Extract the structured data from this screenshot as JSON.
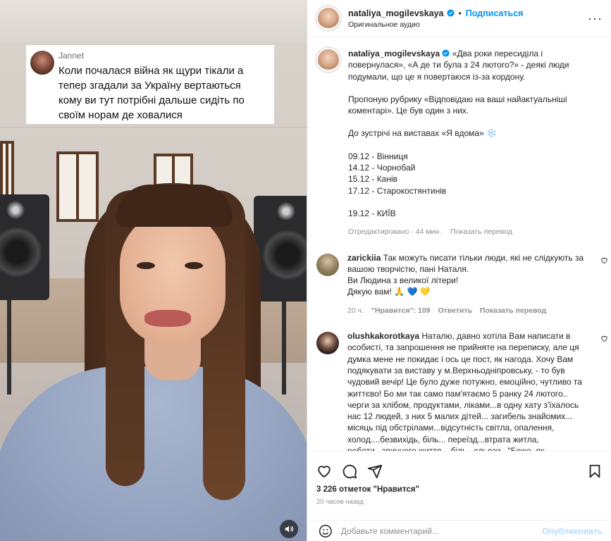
{
  "video": {
    "overlay": {
      "name": "Jannet",
      "text": "Коли почалася війна як щури тікали а тепер згадали за Україну вертаються кому ви тут потрібні дальше сидіть по своїм норам де ховалися"
    },
    "mute_icon": "speaker-icon"
  },
  "header": {
    "username": "nataliya_mogilevskaya",
    "separator": "•",
    "follow_label": "Подписаться",
    "audio_label": "Оригинальное аудио",
    "more_label": "···"
  },
  "caption": {
    "username": "nataliya_mogilevskaya",
    "line1": "«Два роки пересиділа і повернулася», «А де ти була з 24 лютого?» - деякі люди подумали, що це я повертаюся із-за кордону.",
    "line2": "Пропоную рубрику «Відповідаю на ваші найактуальніші коментарі». Це був один з них.",
    "line3": "До зустрічі на виставах «Я вдома» ❄️",
    "dates": [
      "09.12 - Вінниця",
      "14.12 - Чорнобай",
      "15.12 - Канів",
      "17.12 - Старокостянтинів"
    ],
    "last_date": "19.12 - КИЇВ",
    "edited": "Отредактировано · 44 мин.",
    "translate": "Показать перевод"
  },
  "comments": [
    {
      "username": "zarickiia",
      "text_lines": [
        "Так можуть писати тільки люди, які не слідкують за вашою творчістю, пані Наталя.",
        "Ви Людина з великої літери!",
        "Дякую вам! 🙏 💙 💛"
      ],
      "time": "20 ч.",
      "likes": "\"Нравится\": 109",
      "reply": "Ответить",
      "translate": "Показать перевод"
    },
    {
      "username": "olushkakorotkaya",
      "text": "Наталю, давно хотіла Вам написати в особисті, та запрошення не прийняте на переписку, але ця думка мене не покидає і ось це пост, як нагода. Хочу Вам подякувати за виставу у м.Верхньодніпровську, - то був чудовий вечір! Це було дуже потужно, емоційно, чутливо та життєво! Бо ми так само пам'ятаємо 5 ранку 24 лютого.. черги за хлібом, продуктами, ліками...в одну хату з'їхалось нас 12 людей, з них 5 малих дітей... загибель знайомих... місяць під обстрілами...відсутність світла, опалення, холод....безвихідь, біль... переїзд...втрата житла, роботи...звичного життя....біль...сльози...\"Боже, як боляче\"...нескінченний біль....Ваша пісня \"Позивний\" для"
    }
  ],
  "actions": {
    "like_icon": "heart-icon",
    "comment_icon": "comment-icon",
    "share_icon": "share-icon",
    "save_icon": "bookmark-icon"
  },
  "likes_text": "3 226 отметок \"Нравится\"",
  "posted_ago": "20 часов назад",
  "add_comment": {
    "placeholder": "Добавьте комментарий...",
    "publish_label": "Опубликовать",
    "emoji_icon": "smiley-icon"
  },
  "colors": {
    "accent": "#0095f6",
    "publish_disabled": "#b3dbff",
    "muted_text": "#8e8e8e"
  }
}
